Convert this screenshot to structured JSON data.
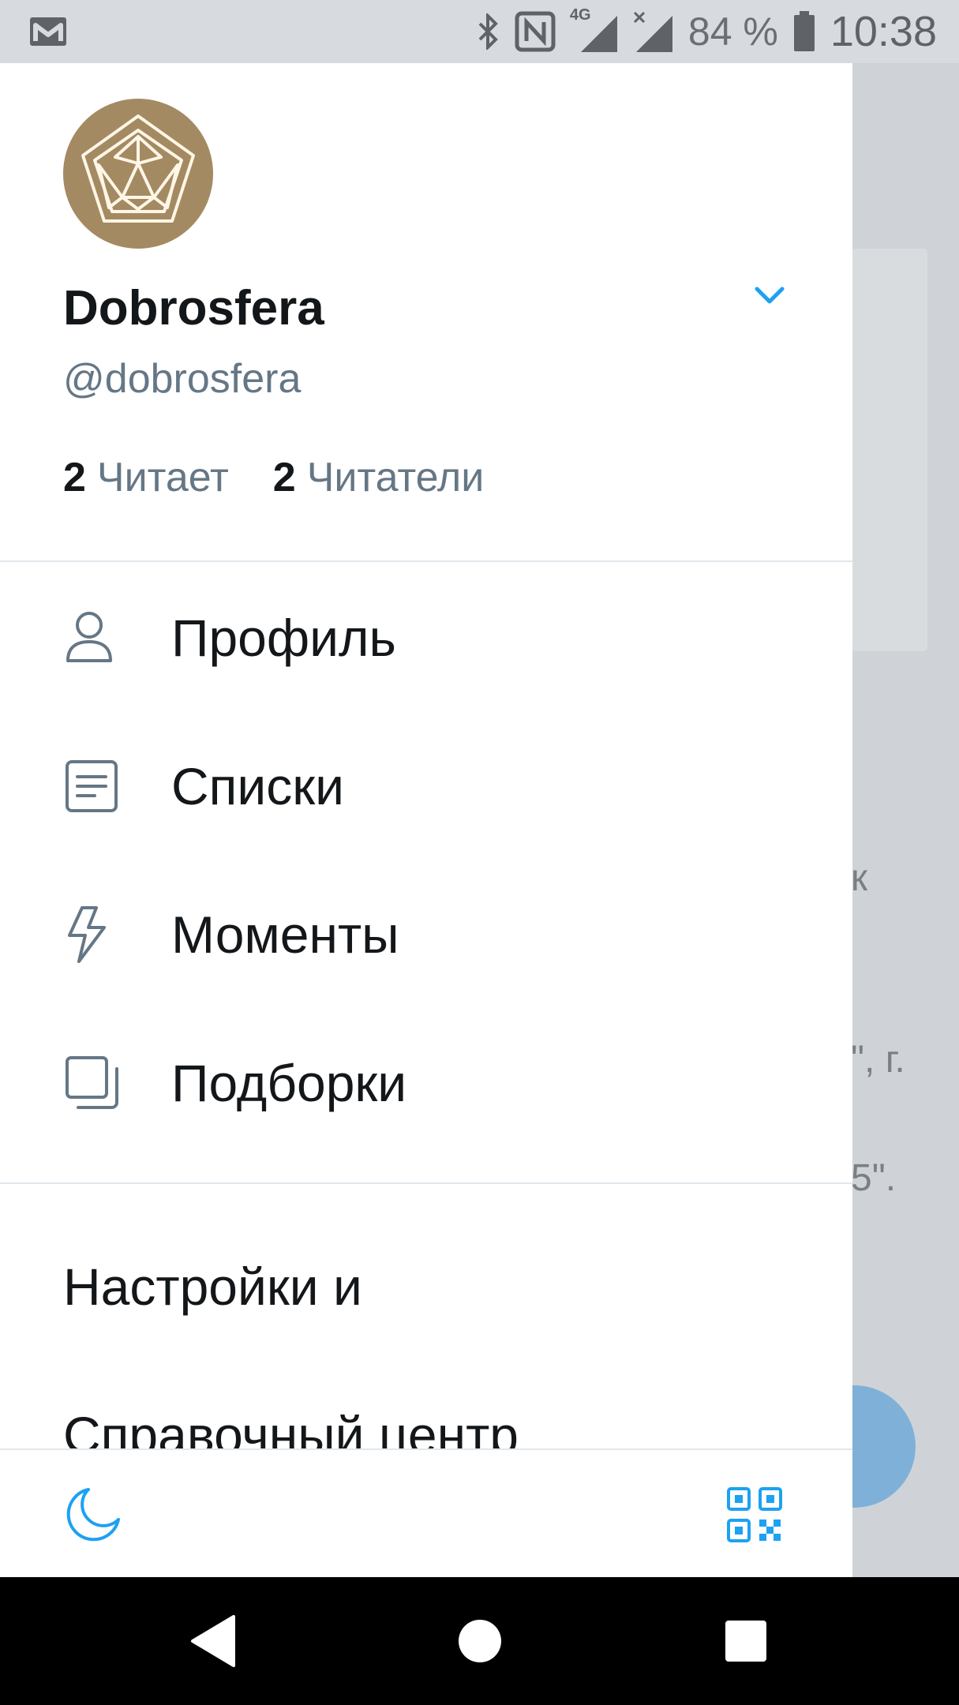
{
  "status_bar": {
    "network_label": "4G",
    "battery_percent": "84 %",
    "time": "10:38"
  },
  "profile": {
    "display_name": "Dobrosfera",
    "handle": "@dobrosfera",
    "following_count": "2",
    "following_label": "Читает",
    "followers_count": "2",
    "followers_label": "Читатели"
  },
  "menu": {
    "items": [
      {
        "label": "Профиль",
        "icon": "person-icon"
      },
      {
        "label": "Списки",
        "icon": "list-icon"
      },
      {
        "label": "Моменты",
        "icon": "lightning-icon"
      },
      {
        "label": "Подборки",
        "icon": "collections-icon"
      }
    ],
    "settings_label": "Настройки и",
    "help_label": "Справочный центр"
  },
  "background": {
    "texts": [
      "к",
      "\", г.",
      "5\"."
    ]
  },
  "colors": {
    "accent": "#1da1f2",
    "text_primary": "#14171a",
    "text_secondary": "#657786",
    "divider": "#e1e8ed"
  }
}
